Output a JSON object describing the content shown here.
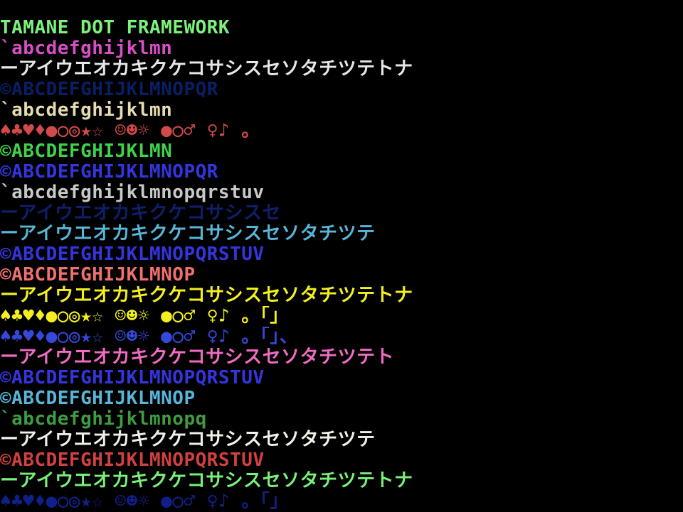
{
  "screen": {
    "title": "TAMANE DOT FRAMEWORK",
    "rows": [
      {
        "text": "TAMANE DOT FRAMEWORK",
        "color": "#7cf27c"
      },
      {
        "text": "`abcdefghijklmn",
        "color": "#d94fc7"
      },
      {
        "text": "ーアイウエオカキクケコサシスセソタチツテトナ",
        "color": "#e6e6e6"
      },
      {
        "text": "©ABCDEFGHIJKLMNOPQR",
        "color": "#0a1f63"
      },
      {
        "text": "`abcdefghijklmn",
        "color": "#e6dcb0"
      },
      {
        "text": "♠♣♥♦●○◎★☆ ☺☻☼ ●○♂ ♀♪ 。",
        "color": "#d24a4a"
      },
      {
        "text": "©ABCDEFGHIJKLMN",
        "color": "#3fd24a"
      },
      {
        "text": "©ABCDEFGHIJKLMNOPQR",
        "color": "#3535e0"
      },
      {
        "text": "`abcdefghijklmnopqrstuv",
        "color": "#c8c8c8"
      },
      {
        "text": "ーアイウエオカキクケコサシスセ",
        "color": "#0f1f6b"
      },
      {
        "text": "ーアイウエオカキクケコサシスセソタチツテ",
        "color": "#57b6d9"
      },
      {
        "text": "©ABCDEFGHIJKLMNOPQRSTUV",
        "color": "#3535e0"
      },
      {
        "text": "©ABCDEFGHIJKLMNOP",
        "color": "#f07070"
      },
      {
        "text": "ーアイウエオカキクケコサシスセソタチツテトナ",
        "color": "#f4f020"
      },
      {
        "text": "♠♣♥♦●○◎★☆ ☺☻☼ ●○♂ ♀♪ 。「」",
        "color": "#f4f020"
      },
      {
        "text": "♠♣♥♦●○◎★☆ ☺☻☼ ●○♂ ♀♪ 。「」、",
        "color": "#3548d9"
      },
      {
        "text": "ーアイウエオカキクケコサシスセソタチツテト",
        "color": "#f06cc4"
      },
      {
        "text": "©ABCDEFGHIJKLMNOPQRSTUV",
        "color": "#3535e0"
      },
      {
        "text": "©ABCDEFGHIJKLMNOP",
        "color": "#57b6d9"
      },
      {
        "text": "`abcdefghijklmnopq",
        "color": "#3f9c3f"
      },
      {
        "text": "ーアイウエオカキクケコサシスセソタチツテ",
        "color": "#f0f0e8"
      },
      {
        "text": "©ABCDEFGHIJKLMNOPQRSTUV",
        "color": "#d24040"
      },
      {
        "text": "ーアイウエオカキクケコサシスセソタチツテトナ",
        "color": "#79f07a"
      },
      {
        "text": "♠♣♥♦●○◎★☆ ☺☻☼ ●○♂ ♀♪ 。「」",
        "color": "#10208a"
      }
    ]
  }
}
